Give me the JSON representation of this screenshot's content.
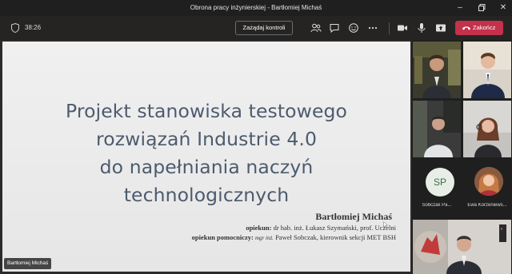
{
  "window": {
    "title": "Obrona pracy inżynierskiej - Bartłomiej Michaś"
  },
  "toolbar": {
    "timer": "38:26",
    "request_control_label": "Zażądaj kontroli",
    "leave_label": "Zakończ",
    "icons": [
      "people-icon",
      "chat-icon",
      "reactions-icon",
      "more-icon",
      "camera-icon",
      "mic-icon",
      "share-icon",
      "phone-icon"
    ],
    "leave_color": "#c4314b"
  },
  "slide": {
    "title_lines": [
      "Projekt stanowiska testowego",
      "rozwiązań Industrie 4.0",
      "do napełniania naczyń",
      "technologicznych"
    ],
    "author": "Bartłomiej Michaś",
    "supervisor_label": "opiekun:",
    "supervisor_value": "dr hab. inż. Łukasz Szymański, prof. Uczelni",
    "assistant_label": "opiekun pomocniczy:",
    "assistant_title": "mgr inż.",
    "assistant_value": "Paweł Sobczak, kierownik sekcji MET BSH",
    "title_color": "#4d5b6e"
  },
  "presenter_badge": "Bartłomiej Michaś",
  "gallery": {
    "sobczak": {
      "initials": "SP",
      "name": "Sobczak Pa..."
    },
    "korzeniewska": {
      "name": "Ewa Korzeniews..."
    }
  }
}
